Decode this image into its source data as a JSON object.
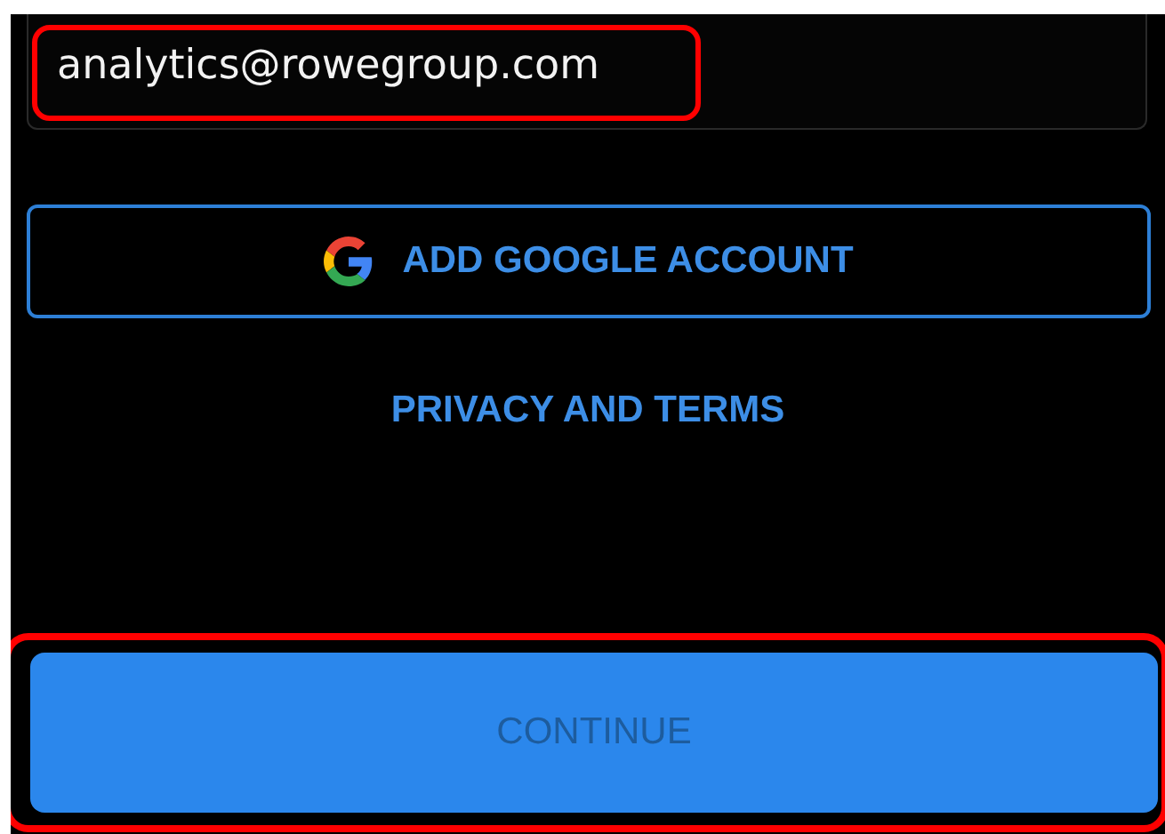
{
  "email_field": {
    "value": "analytics@rowegroup.com",
    "highlighted": true
  },
  "google_button": {
    "label": "ADD GOOGLE ACCOUNT"
  },
  "privacy_link": {
    "label": "PRIVACY AND TERMS"
  },
  "continue_button": {
    "label": "CONTINUE",
    "disabled": true,
    "highlighted": true
  }
}
